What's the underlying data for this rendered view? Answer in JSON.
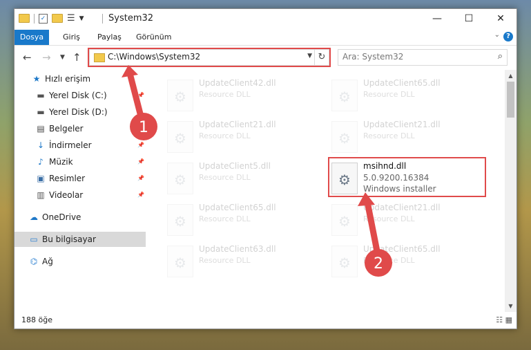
{
  "window": {
    "title": "System32"
  },
  "window_controls": {
    "minimize": "—",
    "maximize": "☐",
    "close": "✕"
  },
  "ribbon": {
    "tabs": [
      "Dosya",
      "Giriş",
      "Paylaş",
      "Görünüm"
    ]
  },
  "address": {
    "path": "C:\\Windows\\System32"
  },
  "search": {
    "placeholder": "Ara: System32"
  },
  "sidebar": {
    "items": [
      {
        "label": "Hızlı erişim",
        "icon": "star-icon",
        "pinned": false
      },
      {
        "label": "Yerel Disk (C:)",
        "icon": "drive-icon",
        "pinned": true
      },
      {
        "label": "Yerel Disk (D:)",
        "icon": "drive-icon",
        "pinned": false
      },
      {
        "label": "Belgeler",
        "icon": "document-icon",
        "pinned": true
      },
      {
        "label": "İndirmeler",
        "icon": "download-icon",
        "pinned": true
      },
      {
        "label": "Müzik",
        "icon": "music-icon",
        "pinned": true
      },
      {
        "label": "Resimler",
        "icon": "pictures-icon",
        "pinned": true
      },
      {
        "label": "Videolar",
        "icon": "video-icon",
        "pinned": true
      },
      {
        "label": "OneDrive",
        "icon": "cloud-icon",
        "pinned": false
      },
      {
        "label": "Bu bilgisayar",
        "icon": "computer-icon",
        "pinned": false,
        "selected": true
      },
      {
        "label": "Ağ",
        "icon": "network-icon",
        "pinned": false
      }
    ]
  },
  "files": [
    {
      "name": "UpdateClient42.dll",
      "sub1": "Resource DLL",
      "sub2": ""
    },
    {
      "name": "UpdateClient65.dll",
      "sub1": "Resource DLL",
      "sub2": ""
    },
    {
      "name": "UpdateClient21.dll",
      "sub1": "Resource DLL",
      "sub2": ""
    },
    {
      "name": "UpdateClient21.dll",
      "sub1": "Resource DLL",
      "sub2": ""
    },
    {
      "name": "UpdateClient5.dll",
      "sub1": "Resource DLL",
      "sub2": ""
    },
    {
      "name": "msihnd.dll",
      "sub1": "5.0.9200.16384",
      "sub2": "Windows installer",
      "active": true
    },
    {
      "name": "UpdateClient65.dll",
      "sub1": "Resource DLL",
      "sub2": ""
    },
    {
      "name": "UpdateClient21.dll",
      "sub1": "Resource DLL",
      "sub2": ""
    },
    {
      "name": "UpdateClient63.dll",
      "sub1": "Resource DLL",
      "sub2": ""
    },
    {
      "name": "UpdateClient65.dll",
      "sub1": "Resource DLL",
      "sub2": ""
    }
  ],
  "status": {
    "count": "188 öğe"
  },
  "annotations": {
    "callout1": "1",
    "callout2": "2",
    "color": "#e04a4a"
  }
}
